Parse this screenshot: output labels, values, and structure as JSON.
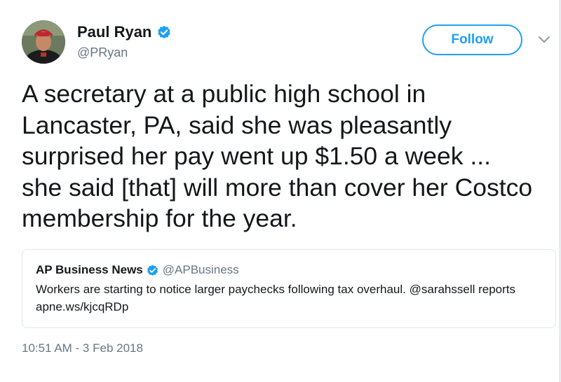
{
  "author": {
    "display_name": "Paul Ryan",
    "handle": "@PRyan",
    "avatar_icon": "profile-photo",
    "verified_icon": "verified-badge-icon"
  },
  "actions": {
    "follow_label": "Follow",
    "menu_icon": "chevron-down-icon"
  },
  "tweet": {
    "text": "A secretary at a public high school in Lancaster, PA, said she was pleasantly surprised her pay went up $1.50 a week ... she said [that] will more than cover her Costco membership for the year.",
    "timestamp": "10:51 AM - 3 Feb 2018"
  },
  "quoted_tweet": {
    "display_name": "AP Business News",
    "handle": "@APBusiness",
    "text": "Workers are starting to notice larger paychecks following tax overhaul. @sarahssell reports apne.ws/kjcqRDp"
  },
  "colors": {
    "accent": "#1da1f2",
    "text_primary": "#14171a",
    "text_secondary": "#657786",
    "border": "#e1e8ed"
  }
}
